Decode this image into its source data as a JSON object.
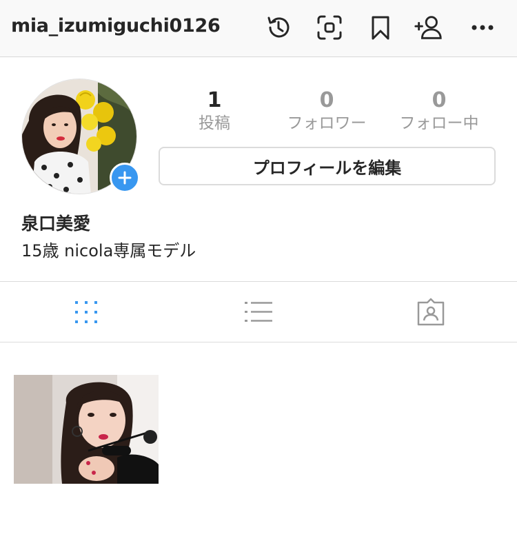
{
  "header": {
    "username": "mia_izumiguchi0126",
    "icons": [
      "archive-history-icon",
      "nametag-scan-icon",
      "saved-bookmark-icon",
      "discover-people-icon",
      "more-options-icon"
    ]
  },
  "profile": {
    "display_name": "泉口美愛",
    "bio": "15歳 nicola専属モデル",
    "edit_button_label": "プロフィールを編集"
  },
  "stats": {
    "posts": {
      "value": "1",
      "label": "投稿"
    },
    "followers": {
      "value": "0",
      "label": "フォロワー"
    },
    "following": {
      "value": "0",
      "label": "フォロー中"
    }
  },
  "tabs": [
    {
      "name": "grid",
      "icon": "grid-icon",
      "active": true
    },
    {
      "name": "list",
      "icon": "list-icon",
      "active": false
    },
    {
      "name": "tagged",
      "icon": "tagged-person-icon",
      "active": false
    }
  ],
  "colors": {
    "accent": "#3897f0",
    "text": "#262626",
    "muted": "#999999",
    "border": "#dbdbdb"
  }
}
